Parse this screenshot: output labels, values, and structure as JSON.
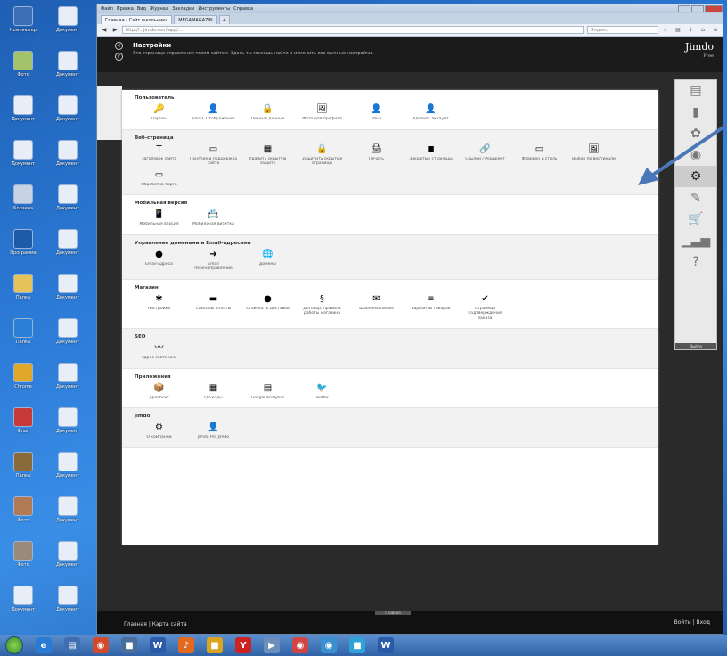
{
  "desktop": {
    "icons": [
      {
        "label": "Компьютер",
        "color": "#3a6fb5"
      },
      {
        "label": "Документ",
        "color": "#e8eef7"
      },
      {
        "label": "Фото",
        "color": "#a4c26a"
      },
      {
        "label": "Документ",
        "color": "#e8eef7"
      },
      {
        "label": "Документ",
        "color": "#e8eef7"
      },
      {
        "label": "Документ",
        "color": "#e8eef7"
      },
      {
        "label": "Документ",
        "color": "#e8eef7"
      },
      {
        "label": "Документ",
        "color": "#e8eef7"
      },
      {
        "label": "Корзина",
        "color": "#c7d3e2"
      },
      {
        "label": "Документ",
        "color": "#e8eef7"
      },
      {
        "label": "Программа",
        "color": "#1e5aa8"
      },
      {
        "label": "Документ",
        "color": "#e8eef7"
      },
      {
        "label": "Папка",
        "color": "#e5c25a"
      },
      {
        "label": "Документ",
        "color": "#e8eef7"
      },
      {
        "label": "Папка",
        "color": "#2b7fd6"
      },
      {
        "label": "Документ",
        "color": "#e8eef7"
      },
      {
        "label": "Chrome",
        "color": "#e0a82b"
      },
      {
        "label": "Документ",
        "color": "#e8eef7"
      },
      {
        "label": "Флаг",
        "color": "#c83a3a"
      },
      {
        "label": "Документ",
        "color": "#e8eef7"
      },
      {
        "label": "Папка",
        "color": "#8a6a3a"
      },
      {
        "label": "Документ",
        "color": "#e8eef7"
      },
      {
        "label": "Фото",
        "color": "#b07a55"
      },
      {
        "label": "Документ",
        "color": "#e8eef7"
      },
      {
        "label": "Фото",
        "color": "#9a8a7a"
      },
      {
        "label": "Документ",
        "color": "#e8eef7"
      },
      {
        "label": "Документ",
        "color": "#e8eef7"
      },
      {
        "label": "Документ",
        "color": "#e8eef7"
      }
    ]
  },
  "browser": {
    "menu": [
      "Файл",
      "Правка",
      "Вид",
      "Журнал",
      "Закладки",
      "Инструменты",
      "Справка"
    ],
    "tabs": [
      {
        "label": "Главная - Сайт школьника",
        "active": true
      },
      {
        "label": "MEGAMAGAZIN",
        "active": false
      }
    ],
    "new_tab": "+",
    "url": "http://...jimdo.com/app/...",
    "search_placeholder": "Яндекс"
  },
  "jimdo": {
    "title": "Настройки",
    "subtitle": "Это страница управления твоим сайтом. Здесь ты можешь найти и изменить все важные настройки.",
    "brand": "Jimdo",
    "brand_sub": "Free",
    "sections": [
      {
        "title": "Пользователь",
        "items": [
          {
            "label": "Пароль",
            "icon": "🔑",
            "icon_name": "key-icon"
          },
          {
            "label": "Email. Отображение",
            "icon": "👤",
            "icon_name": "user-icon"
          },
          {
            "label": "Личные данные",
            "icon": "🔒",
            "icon_name": "lock-icon"
          },
          {
            "label": "Фото для профиля",
            "icon": "🖼",
            "icon_name": "profile-photo-icon"
          },
          {
            "label": "Язык",
            "icon": "👤",
            "icon_name": "language-icon"
          },
          {
            "label": "Удалить аккаунт",
            "icon": "👤",
            "icon_name": "delete-account-icon"
          }
        ]
      },
      {
        "title": "Веб-страница",
        "items": [
          {
            "label": "Заголовок сайта",
            "icon": "T",
            "icon_name": "site-title-icon"
          },
          {
            "label": "Понятие и поддержка сайта",
            "icon": "▭",
            "icon_name": "support-icon"
          },
          {
            "label": "Удалить скрытую защиту",
            "icon": "▦",
            "icon_name": "protection-icon"
          },
          {
            "label": "Защитить скрытые страницы",
            "icon": "🔒",
            "icon_name": "hidden-pages-icon"
          },
          {
            "label": "Печать",
            "icon": "🖨",
            "icon_name": "print-icon"
          },
          {
            "label": "Закрытые страницы",
            "icon": "◼",
            "icon_name": "closed-pages-icon"
          },
          {
            "label": "Ссылки / Редирект",
            "icon": "🔗",
            "icon_name": "redirect-icon"
          },
          {
            "label": "Фавикон и стиль",
            "icon": "▭",
            "icon_name": "favicon-icon"
          },
          {
            "label": "Выбор по вертикали",
            "icon": "🖼",
            "icon_name": "vertical-select-icon"
          },
          {
            "label": "Обработка тарга",
            "icon": "▭",
            "icon_name": "processing-icon"
          }
        ]
      },
      {
        "title": "Мобильная версия",
        "items": [
          {
            "label": "Мобильная версия",
            "icon": "📱",
            "icon_name": "mobile-icon"
          },
          {
            "label": "Мобильная визитка",
            "icon": "📇",
            "icon_name": "mobile-card-icon"
          }
        ]
      },
      {
        "title": "Управление доменами и Email-адресами",
        "items": [
          {
            "label": "Email-адреса",
            "icon": "●",
            "icon_name": "email-icon"
          },
          {
            "label": "Email перенаправление",
            "icon": "➜",
            "icon_name": "email-forward-icon"
          },
          {
            "label": "Домены",
            "icon": "🌐",
            "icon_name": "domains-icon"
          }
        ]
      },
      {
        "title": "Магазин",
        "items": [
          {
            "label": "Настройки",
            "icon": "✱",
            "icon_name": "shop-settings-icon"
          },
          {
            "label": "Способы оплаты",
            "icon": "▬",
            "icon_name": "payment-icon"
          },
          {
            "label": "Стоимость доставки",
            "icon": "●",
            "icon_name": "shipping-icon"
          },
          {
            "label": "Договор, правила работы магазина",
            "icon": "§",
            "icon_name": "terms-icon"
          },
          {
            "label": "Шаблоны писем",
            "icon": "✉",
            "icon_name": "email-templates-icon"
          },
          {
            "label": "Варианты товаров",
            "icon": "≡",
            "icon_name": "variants-icon"
          },
          {
            "label": "Страница подтверждения заказа",
            "icon": "✔",
            "icon_name": "order-confirm-icon"
          }
        ]
      },
      {
        "title": "SEO",
        "items": [
          {
            "label": "Адрес сайта SEO",
            "icon": "〰",
            "icon_name": "seo-icon"
          }
        ]
      },
      {
        "title": "Приложения",
        "items": [
          {
            "label": "Дропбокс",
            "icon": "📦",
            "icon_name": "dropbox-icon"
          },
          {
            "label": "QR-коды",
            "icon": "▦",
            "icon_name": "qr-icon"
          },
          {
            "label": "Google Analytics",
            "icon": "▤",
            "icon_name": "analytics-icon"
          },
          {
            "label": "Twitter",
            "icon": "🐦",
            "icon_name": "twitter-icon"
          }
        ]
      },
      {
        "title": "Jimdo",
        "items": [
          {
            "label": "О компании",
            "icon": "⚙",
            "icon_name": "about-icon"
          },
          {
            "label": "Jimdo Pro Jimdo",
            "icon": "👤",
            "icon_name": "jimdo-pro-icon"
          }
        ]
      }
    ],
    "sidebar": [
      {
        "icon": "▤",
        "name": "layout-icon",
        "active": false
      },
      {
        "icon": "▮",
        "name": "design-icon",
        "active": false
      },
      {
        "icon": "✿",
        "name": "style-icon",
        "active": false
      },
      {
        "icon": "◉",
        "name": "blog-icon",
        "active": false
      },
      {
        "icon": "⚙",
        "name": "settings-icon",
        "active": true
      },
      {
        "icon": "✎",
        "name": "edit-icon",
        "active": false
      },
      {
        "icon": "🛒",
        "name": "store-icon",
        "active": false
      },
      {
        "icon": "▁▃▅",
        "name": "stats-icon",
        "active": false
      },
      {
        "icon": "?",
        "name": "help-icon",
        "active": false
      }
    ],
    "sidebar_footer": "Выйти",
    "bottom_handle": "Главная",
    "bottom_left": "Главная | Карта сайта",
    "bottom_right": "Войти | Вход"
  },
  "annotation": {
    "color": "#4a77b8"
  },
  "taskbar": {
    "apps": [
      {
        "icon": "e",
        "color": "#2a7bd4"
      },
      {
        "icon": "▤",
        "color": "#3f6fb1"
      },
      {
        "icon": "◉",
        "color": "#d34a2a"
      },
      {
        "icon": "■",
        "color": "#4a6e9a"
      },
      {
        "icon": "W",
        "color": "#2b5aa8"
      },
      {
        "icon": "♪",
        "color": "#e26a1e"
      },
      {
        "icon": "■",
        "color": "#d9a520"
      },
      {
        "icon": "Y",
        "color": "#cc2222"
      },
      {
        "icon": "▶",
        "color": "#6b8fb8"
      },
      {
        "icon": "◉",
        "color": "#d04545"
      },
      {
        "icon": "◉",
        "color": "#3a8fd0"
      },
      {
        "icon": "■",
        "color": "#2fa3d8"
      },
      {
        "icon": "W",
        "color": "#2b5aa8"
      }
    ]
  }
}
